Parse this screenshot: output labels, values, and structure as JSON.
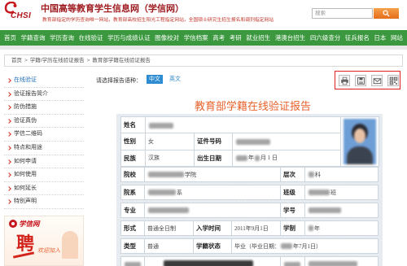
{
  "header": {
    "logo_text": "CHSI",
    "title": "中国高等教育学生信息网（学信网）",
    "subtitle": "教育部指定的学历查询唯一网站，教育部高校招生阳光工程指定网站，全国硕士研究生招生报名和调剂指定网站",
    "search": {
      "placeholder": "搜索",
      "button_icon": "search-icon"
    }
  },
  "nav": {
    "items": [
      "首页",
      "学籍查询",
      "学历查询",
      "在线验证",
      "学历与成绩认证",
      "图像校对",
      "学信档案",
      "高考",
      "考研",
      "就业招生",
      "港澳台招生",
      "四六级查分",
      "征兵报名",
      "日本",
      "网站"
    ]
  },
  "breadcrumb": {
    "separator": ">",
    "items": [
      "首页",
      "学籍/学历在线验证报告",
      "教育部学籍在线验证报告"
    ]
  },
  "sidebar": {
    "items": [
      {
        "label": "在线验证",
        "active": true
      },
      {
        "label": "验证报告简介",
        "active": false
      },
      {
        "label": "防伪措施",
        "active": false
      },
      {
        "label": "验证真伪",
        "active": false
      },
      {
        "label": "学信二维码",
        "active": false
      },
      {
        "label": "特点和用途",
        "active": false
      },
      {
        "label": "如何申请",
        "active": false
      },
      {
        "label": "如何使用",
        "active": false
      },
      {
        "label": "如何延长",
        "active": false
      },
      {
        "label": "特别声明",
        "active": false
      }
    ]
  },
  "ad": {
    "brand": "学信网",
    "headline": "聘",
    "tagline": "欢迎加入"
  },
  "report": {
    "language_prompt": "请选择报告语种：",
    "languages": [
      {
        "label": "中文",
        "selected": true
      },
      {
        "label": "英文",
        "selected": false
      }
    ],
    "toolbar_icons": [
      "printer-icon",
      "save-icon",
      "mail-icon",
      "qr-code-icon"
    ],
    "title": "教育部学籍在线验证报告",
    "fields": {
      "name": {
        "label": "姓名"
      },
      "gender": {
        "label": "性别",
        "value": "女"
      },
      "id_number": {
        "label": "证件号码"
      },
      "ethnicity": {
        "label": "民族",
        "value": "汉族"
      },
      "birth_date": {
        "label": "出生日期",
        "visible_parts": [
          "年",
          "月 1 日"
        ]
      },
      "school": {
        "label": "院校",
        "visible_parts": [
          "学院"
        ]
      },
      "level": {
        "label": "层次",
        "visible_parts": [
          "科"
        ]
      },
      "department": {
        "label": "院系",
        "visible_parts": [
          "系"
        ]
      },
      "class": {
        "label": "班级",
        "visible_parts": [
          "班"
        ]
      },
      "major": {
        "label": "专业"
      },
      "student_id": {
        "label": "学号"
      },
      "study_mode": {
        "label": "形式",
        "value": "普通全日制"
      },
      "enrollment_date": {
        "label": "入学时间",
        "value": "2011年9月1日"
      },
      "duration": {
        "label": "学制",
        "visible_parts": [
          "年"
        ]
      },
      "type": {
        "label": "类型",
        "value": "普通"
      },
      "status": {
        "label": "学籍状态",
        "visible_parts": [
          "毕业（毕业日期：",
          "年7月1日）"
        ]
      }
    }
  },
  "colors": {
    "brand_red": "#9e1c20",
    "nav_green": "#3b983e",
    "title_orange": "#e8622c",
    "link_blue": "#2d8bd1",
    "annotation_red": "#e02020",
    "search_button_orange": "#e46d1a"
  }
}
